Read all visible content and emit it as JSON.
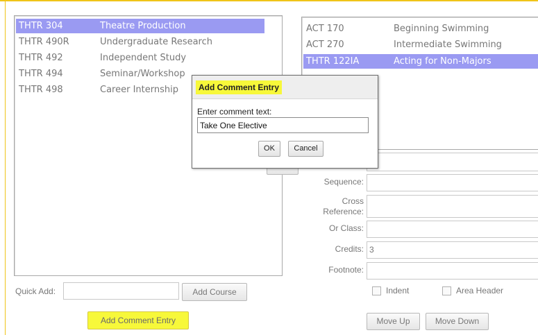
{
  "course_list": {
    "items": [
      {
        "code": "THTR 304",
        "title": "Theatre Production",
        "selected": true
      },
      {
        "code": "THTR 490R",
        "title": "Undergraduate Research",
        "selected": false
      },
      {
        "code": "THTR 492",
        "title": "Independent Study",
        "selected": false
      },
      {
        "code": "THTR 494",
        "title": "Seminar/Workshop",
        "selected": false
      },
      {
        "code": "THTR 498",
        "title": "Career Internship",
        "selected": false
      }
    ]
  },
  "requirement_list": {
    "items": [
      {
        "code": "ACT 170",
        "title": "Beginning Swimming",
        "selected": false
      },
      {
        "code": "ACT 270",
        "title": "Intermediate Swimming",
        "selected": false
      },
      {
        "code": "THTR 122IA",
        "title": "Acting for Non-Majors",
        "selected": true
      }
    ]
  },
  "quick_add": {
    "label": "Quick Add:",
    "value": "",
    "button": "Add Course"
  },
  "add_comment_button": "Add Comment Entry",
  "details": {
    "sequence_label": "Sequence:",
    "cross_reference_label_1": "Cross",
    "cross_reference_label_2": "Reference:",
    "or_class_label": "Or Class:",
    "credits_label": "Credits:",
    "credits_value": "3",
    "footnote_label": "Footnote:",
    "indent_label": "Indent",
    "area_header_label": "Area Header",
    "move_up": "Move Up",
    "move_down": "Move Down"
  },
  "dialog": {
    "title": "Add Comment Entry",
    "prompt": "Enter comment text:",
    "input_value": "Take One Elective",
    "ok": "OK",
    "cancel": "Cancel"
  },
  "colors": {
    "selection": "#9a9af2",
    "highlight": "#f7f83a",
    "frame_accent": "#f0c419"
  }
}
